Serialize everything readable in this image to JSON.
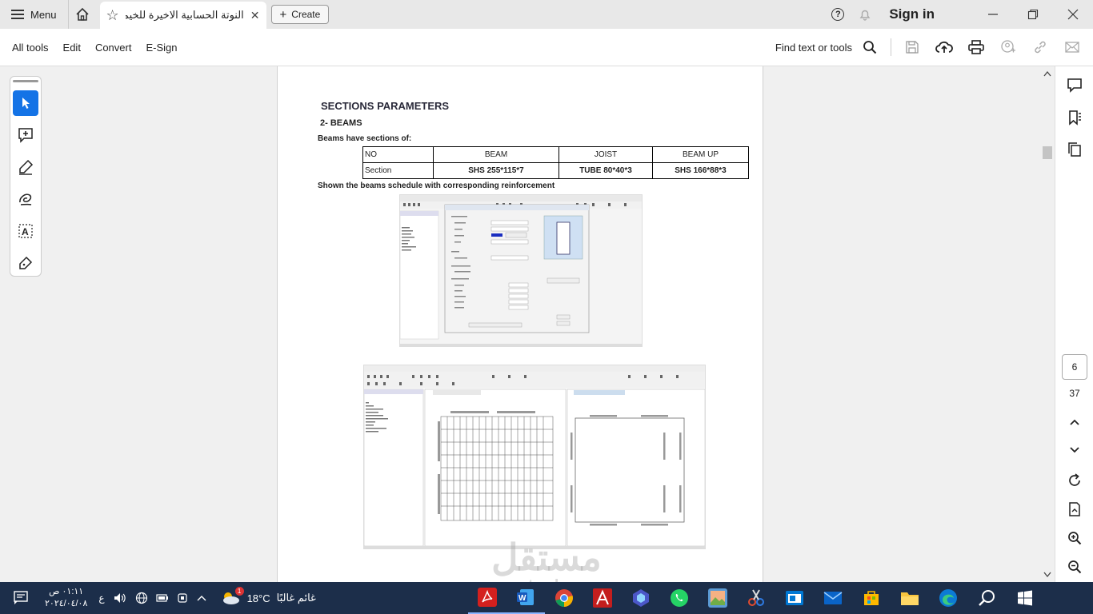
{
  "titlebar": {
    "menu_label": "Menu",
    "tab_title": "النوتة الحسابية الاخيرة للخيمة...",
    "create_label": "Create",
    "sign_in": "Sign in"
  },
  "toolbar": {
    "items": [
      "All tools",
      "Edit",
      "Convert",
      "E-Sign"
    ],
    "find_text": "Find text or tools"
  },
  "document": {
    "section_title": "SECTIONS PARAMETERS",
    "subtitle": "2- BEAMS",
    "intro": "Beams have sections of:",
    "table": {
      "header": [
        "NO",
        "BEAM",
        "JOIST",
        "BEAM UP"
      ],
      "row": [
        "Section",
        "SHS 255*115*7",
        "TUBE 80*40*3",
        "SHS 166*88*3"
      ]
    },
    "caption": "Shown the beams schedule with corresponding reinforcement"
  },
  "page_nav": {
    "current": "6",
    "total": "37"
  },
  "taskbar": {
    "time": "٠١:١١ ص",
    "date": "٢٠٢٤/٠٤/٠٨",
    "lang": "ع",
    "weather_text": "غائم غالبًا",
    "temperature": "18°C",
    "weather_badge": "1"
  },
  "watermark": {
    "arabic": "مستقل",
    "latin": "mostaql.com"
  }
}
